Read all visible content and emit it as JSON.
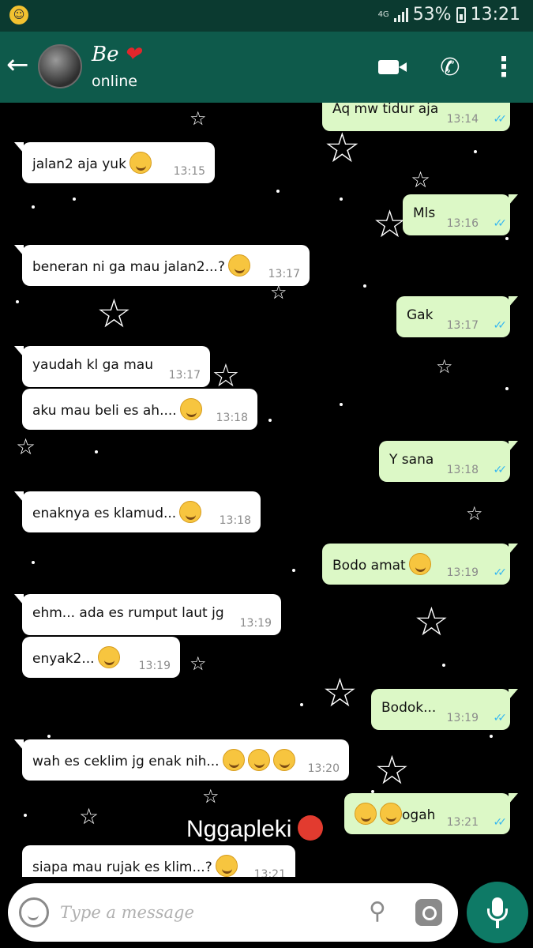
{
  "status_bar": {
    "network": "4G",
    "battery": "53%",
    "time": "13:21"
  },
  "header": {
    "contact_name": "Be",
    "contact_status": "online",
    "back_icon": "back-arrow-icon",
    "heart_icon": "heart-icon",
    "actions": [
      "video-call-icon",
      "phone-icon",
      "more-options-icon"
    ]
  },
  "messages": [
    {
      "dir": "out",
      "text": "Aq mw tidur aja",
      "time": "13:14",
      "read": true
    },
    {
      "dir": "in",
      "text": "jalan2 aja yuk",
      "time": "13:15",
      "emoji": "grinning-face"
    },
    {
      "dir": "out",
      "text": "Mls",
      "time": "13:16",
      "read": true
    },
    {
      "dir": "in",
      "text": "beneran ni ga mau jalan2...?",
      "time": "13:17",
      "emoji": "smirking-face"
    },
    {
      "dir": "out",
      "text": "Gak",
      "time": "13:17",
      "read": true
    },
    {
      "dir": "in",
      "text": "yaudah kl ga mau",
      "time": "13:17"
    },
    {
      "dir": "in",
      "text": "aku mau beli es ah....",
      "time": "13:18",
      "emoji": "smirking-face"
    },
    {
      "dir": "out",
      "text": "Y sana",
      "time": "13:18",
      "read": true
    },
    {
      "dir": "in",
      "text": "enaknya es klamud...",
      "time": "13:18",
      "emoji": "relieved-face"
    },
    {
      "dir": "out",
      "text": "Bodo amat",
      "time": "13:19",
      "read": true,
      "emoji": "smirking-face"
    },
    {
      "dir": "in",
      "text": "ehm... ada es rumput laut jg",
      "time": "13:19"
    },
    {
      "dir": "in",
      "text": "enyak2...",
      "time": "13:19",
      "emoji": "relieved-face"
    },
    {
      "dir": "out",
      "text": "Bodok...",
      "time": "13:19",
      "read": true
    },
    {
      "dir": "in",
      "text": "wah es ceklim jg enak nih...",
      "time": "13:20",
      "emoji": "relieved-face x3"
    },
    {
      "dir": "out",
      "text": "ogah",
      "time": "13:21",
      "read": true,
      "emoji": "smirking-face x2"
    },
    {
      "dir": "in",
      "text": "siapa mau rujak es klim...?",
      "time": "13:21",
      "emoji": "smirking-face"
    }
  ],
  "overlay_caption": "Nggapleki",
  "input": {
    "placeholder": "Type a message"
  },
  "colors": {
    "status_bar": "#0b3a30",
    "header": "#0e5a4b",
    "incoming_bubble": "#ffffff",
    "outgoing_bubble": "#dcf8c6",
    "read_tick": "#34b7f1",
    "mic_button": "#0e7a66"
  }
}
